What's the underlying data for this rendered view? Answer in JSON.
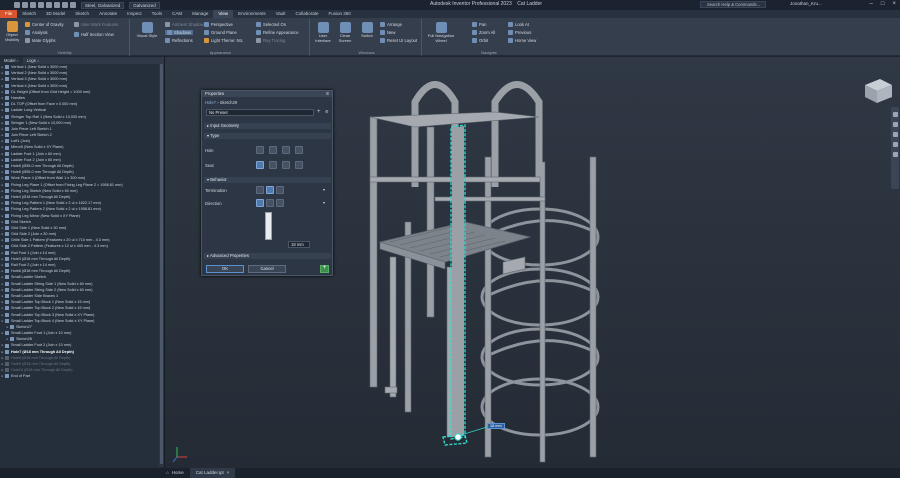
{
  "titlebar": {
    "style_selector": "Steel, Galvanized",
    "appearance_selector": "Galvanized",
    "app_title": "Autodesk Inventor Professional 2023",
    "document_title": "Cat Ladder",
    "search_placeholder": "Search Help & Commands...",
    "user": "Jonathan_Kru..."
  },
  "tabs": [
    "File",
    "Sketch",
    "3D Model",
    "Sketch",
    "Annotate",
    "Inspect",
    "Tools",
    "CAM",
    "Manage",
    "View",
    "Environments",
    "Vault",
    "Collaborate",
    "Fusion 360"
  ],
  "ribbon": {
    "visibility": {
      "title": "Visibility",
      "object_visibility": "Object Visibility",
      "center_of_gravity": "Center of Gravity",
      "analysis": "Analysis",
      "mate_glyphs": "Mate Glyphs",
      "user_work_features": "User Work Features",
      "half_section_view": "Half Section View"
    },
    "appearance": {
      "title": "Appearance",
      "visual_style": "Visual Style",
      "shadows": "Shadows",
      "reflections": "Reflections",
      "perspective": "Perspective",
      "ground_plane": "Ground Plane",
      "light_theme": "Light Theme: NIL",
      "selected_on": "Selected On",
      "refine_appearance": "Refine Appearance",
      "ray_tracing": "Ray Tracing",
      "ambient_shadows": "Ambient Shadows"
    },
    "windows": {
      "title": "Windows",
      "user_interface": "User Interface",
      "clean_screen": "Clean Screen",
      "switch": "Switch",
      "arrange": "Arrange",
      "new": "New",
      "reset_ui_layout": "Reset UI Layout"
    },
    "navigate": {
      "title": "Navigate",
      "full_nav_wheel": "Full Navigation Wheel",
      "pan": "Pan",
      "zoom_all": "Zoom All",
      "orbit": "Orbit",
      "look_at": "Look At",
      "previous": "Previous",
      "home_view": "Home View"
    }
  },
  "browser": {
    "tabs": [
      "Model",
      "Logs"
    ],
    "items": [
      {
        "label": "Vertical 1 (New Solid x 3000 mm)",
        "state": "normal",
        "indent": false
      },
      {
        "label": "Vertical 2 (New Solid x 3000 mm)",
        "state": "normal",
        "indent": false
      },
      {
        "label": "Vertical 3 (New Solid x 3000 mm)",
        "state": "normal",
        "indent": false
      },
      {
        "label": "Vertical 4 (New Solid x 3000 mm)",
        "state": "normal",
        "indent": false
      },
      {
        "label": "DL Height (Offset from Grid Height = 1000 mm)",
        "state": "normal",
        "indent": false
      },
      {
        "label": "Handles",
        "state": "normal",
        "indent": false
      },
      {
        "label": "DL TOP (Offset from Face x 0.000 mm)",
        "state": "normal",
        "indent": false
      },
      {
        "label": "Ladder Long Vertical",
        "state": "normal",
        "indent": false
      },
      {
        "label": "Stringer Top Rail 1 (New Solid x 10,000 mm)",
        "state": "normal",
        "indent": false
      },
      {
        "label": "Stringer 1 (New Solid x 10,000 mm)",
        "state": "normal",
        "indent": false
      },
      {
        "label": "Join Piece Left Sketch 1",
        "state": "normal",
        "indent": false
      },
      {
        "label": "Join Piece Left Sketch 2",
        "state": "normal",
        "indent": false
      },
      {
        "label": "Loft1 (Join)",
        "state": "normal",
        "indent": false
      },
      {
        "label": "Mirror5 (New Solid x XY Plane)",
        "state": "normal",
        "indent": false
      },
      {
        "label": "Ladder Foot 1 (Join x 60 mm)",
        "state": "normal",
        "indent": false
      },
      {
        "label": "Ladder Foot 2 (Join x 60 mm)",
        "state": "normal",
        "indent": false
      },
      {
        "label": "Hole5 (Ø55.0 mm Through All Depth)",
        "state": "normal",
        "indent": false
      },
      {
        "label": "Hole6 (Ø55.0 mm Through All Depth)",
        "state": "normal",
        "indent": false
      },
      {
        "label": "Work Plane 4 (Offset from Wall 1 x 300 mm)",
        "state": "normal",
        "indent": false
      },
      {
        "label": "Fixing Leg Plane 1 (Offset from Fixing Leg Plane 2 = 1958.81 mm)",
        "state": "normal",
        "indent": false
      },
      {
        "label": "Fixing Leg Sketch (New Solid x 60 mm)",
        "state": "normal",
        "indent": false
      },
      {
        "label": "Hole4 (Ø18 mm Through All Depth)",
        "state": "normal",
        "indent": false
      },
      {
        "label": "Fixing Leg Pattern 1 (New Solid x 2 ul x 1622.17 mm)",
        "state": "normal",
        "indent": false
      },
      {
        "label": "Fixing Leg Pattern 2 (New Solid x 2 ul x 1958.81 mm)",
        "state": "normal",
        "indent": false
      },
      {
        "label": "Fixing Leg Mirror (New Solid x XY Plane)",
        "state": "normal",
        "indent": false
      },
      {
        "label": "Grid Sketch",
        "state": "normal",
        "indent": false
      },
      {
        "label": "Grid Side 1 (New Solid x 30 mm)",
        "state": "normal",
        "indent": false
      },
      {
        "label": "Grid Side 2 (Join x 30 mm)",
        "state": "normal",
        "indent": false
      },
      {
        "label": "Grille Side 1 Pattern (Features x 20 ul x 710 mm - 4.3 mm)",
        "state": "normal",
        "indent": false
      },
      {
        "label": "Grid Side 2 Pattern (Features x 12 ul x 400 mm - 4.3 mm)",
        "state": "normal",
        "indent": false
      },
      {
        "label": "Rail Foot 1 (Join x 14 mm)",
        "state": "normal",
        "indent": false
      },
      {
        "label": "Hole3 (Ø18 mm Through All Depth)",
        "state": "normal",
        "indent": false
      },
      {
        "label": "Rail Foot 2 (Join x 14 mm)",
        "state": "normal",
        "indent": false
      },
      {
        "label": "Hole6 (Ø18 mm Through All Depth)",
        "state": "normal",
        "indent": false
      },
      {
        "label": "Small Ladder Sketch",
        "state": "normal",
        "indent": false
      },
      {
        "label": "Small Ladder String Side 1 (New Solid x 60 mm)",
        "state": "normal",
        "indent": false
      },
      {
        "label": "Small Ladder String Side 2 (New Solid x 60 mm)",
        "state": "normal",
        "indent": false
      },
      {
        "label": "Small Ladder Side Braces 1",
        "state": "normal",
        "indent": false
      },
      {
        "label": "Small Ladder Top Block 1 (New Solid x 15 mm)",
        "state": "normal",
        "indent": false
      },
      {
        "label": "Small Ladder Top Block 2 (New Solid x 15 mm)",
        "state": "normal",
        "indent": false
      },
      {
        "label": "Small Ladder Top Block 3 (New Solid x XY Plane)",
        "state": "normal",
        "indent": false
      },
      {
        "label": "Small Ladder Top Block 4 (New Solid x XY Plane)",
        "state": "normal",
        "indent": false
      },
      {
        "label": "Sketch27",
        "state": "normal",
        "indent": true
      },
      {
        "label": "Small Ladder Foot 1 (Join x 10 mm)",
        "state": "normal",
        "indent": false
      },
      {
        "label": "Sketch28",
        "state": "normal",
        "indent": true
      },
      {
        "label": "Small Ladder Foot 2 (Join x 10 mm)",
        "state": "normal",
        "indent": false
      },
      {
        "label": "Hole7 (Ø18 mm Through All Depth)",
        "state": "bold",
        "indent": false
      },
      {
        "label": "Hole8 (Ø18 mm Through All Depth)",
        "state": "dim",
        "indent": false
      },
      {
        "label": "Hole9 (Ø18 mm Through All Depth)",
        "state": "dim",
        "indent": false
      },
      {
        "label": "Hole10 (Ø18 mm Through All Depth)",
        "state": "dim",
        "indent": false
      },
      {
        "label": "End of Part",
        "state": "normal",
        "indent": false
      }
    ]
  },
  "properties": {
    "title": "Properties",
    "breadcrumb_feature": "Hole7",
    "breadcrumb_sketch": "Sketch29",
    "preset": "No Preset",
    "input_geometry": "Input Geometry",
    "type_section": "Type",
    "hole_label": "Hole",
    "seat_label": "Seat",
    "behavior_section": "Behavior",
    "termination_label": "Termination",
    "direction_label": "Direction",
    "diameter_value": "18 mm",
    "advanced_properties": "Advanced Properties",
    "ok": "OK",
    "cancel": "Cancel",
    "add": "+"
  },
  "viewport": {
    "dimension_label": "18 mm"
  },
  "status": {
    "home_tab": "Home",
    "doc_tab": "Cat Ladder.ipt"
  },
  "colors": {
    "accent_orange": "#d9542c",
    "selection_cyan": "#2fd6c8",
    "model_gray": "#9aa0a6",
    "background": "#2a323d"
  }
}
